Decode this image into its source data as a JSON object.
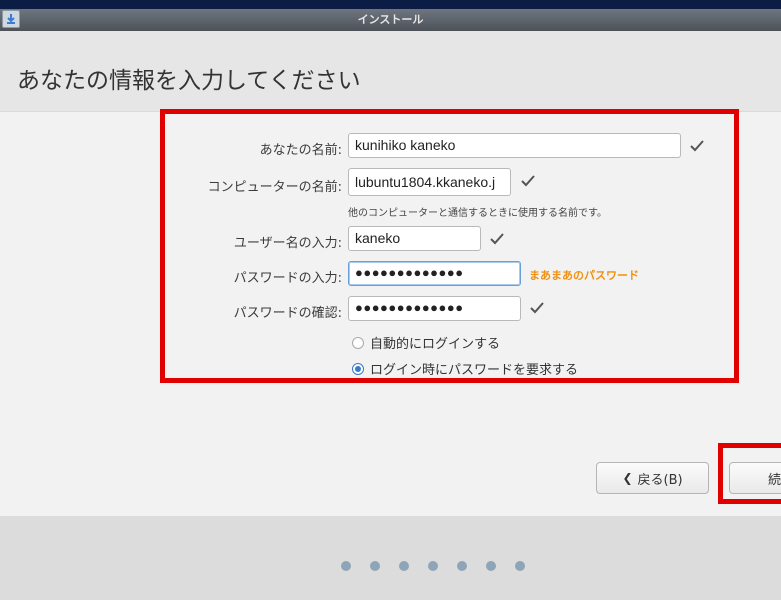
{
  "window": {
    "title": "インストール"
  },
  "header": {
    "title": "あなたの情報を入力してください"
  },
  "form": {
    "name_label": "あなたの名前:",
    "name_value": "kunihiko kaneko",
    "computer_label": "コンピューターの名前:",
    "computer_value": "lubuntu1804.kkaneko.j",
    "computer_hint": "他のコンピューターと通信するときに使用する名前です。",
    "username_label": "ユーザー名の入力:",
    "username_value": "kaneko",
    "password_label": "パスワードの入力:",
    "password_value": "●●●●●●●●●●●●●",
    "password_strength": "まあまあのパスワード",
    "confirm_label": "パスワードの確認:",
    "confirm_value": "●●●●●●●●●●●●●",
    "auto_login_label": "自動的にログインする",
    "require_password_label": "ログイン時にパスワードを要求する",
    "selected_login_option": "require_password"
  },
  "buttons": {
    "back_label": "戻る(B)",
    "continue_label": "続"
  },
  "progress": {
    "total_steps": 7
  },
  "colors": {
    "highlight": "#e00000",
    "strength_text": "#f0900e",
    "check": "#555555",
    "radio_selected": "#3a78c8",
    "progress_dot": "#8fa4b8"
  },
  "icons": [
    "installer-app-icon",
    "checkmark-icon",
    "chevron-left-icon",
    "radio-button-icon"
  ]
}
